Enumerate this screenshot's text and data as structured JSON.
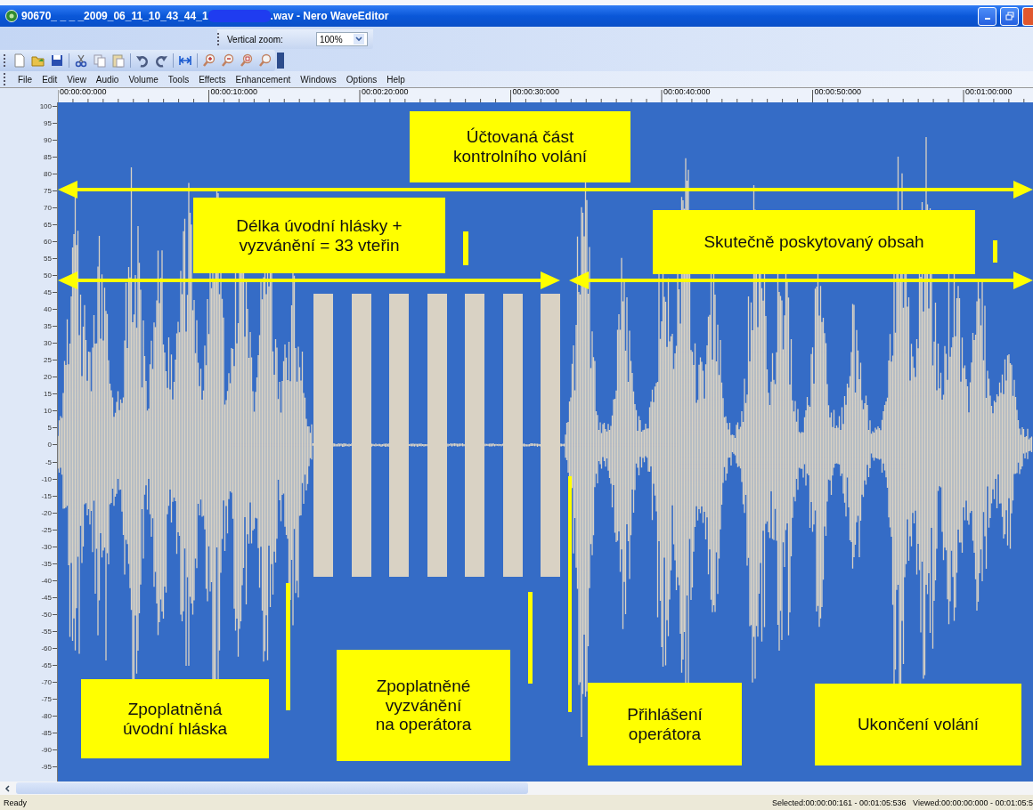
{
  "window": {
    "title_start": "90670_ _ _ _2009_06_11_10_43_44_1",
    "title_end": ".wav - Nero WaveEditor"
  },
  "toolbar": {
    "vertical_zoom_label": "Vertical zoom:",
    "vertical_zoom_value": "100%"
  },
  "menu": [
    "File",
    "Edit",
    "View",
    "Audio",
    "Volume",
    "Tools",
    "Effects",
    "Enhancement",
    "Windows",
    "Options",
    "Help"
  ],
  "ruler_labels": [
    "00:00:00:000",
    "00:00:10:000",
    "00:00:20:000",
    "00:00:30:000",
    "00:00:40:000",
    "00:00:50:000",
    "00:01:00:000"
  ],
  "y_axis_labels": [
    "100",
    "95",
    "90",
    "85",
    "80",
    "75",
    "70",
    "65",
    "60",
    "55",
    "50",
    "45",
    "40",
    "35",
    "30",
    "25",
    "20",
    "15",
    "10",
    "5",
    "0",
    "-5",
    "-10",
    "-15",
    "-20",
    "-25",
    "-30",
    "-35",
    "-40",
    "-45",
    "-50",
    "-55",
    "-60",
    "-65",
    "-70",
    "-75",
    "-80",
    "-85",
    "-90",
    "-95"
  ],
  "annotations": [
    {
      "text": "Účtovaná část\nkontrolního volání"
    },
    {
      "text": "Délka úvodní hlásky +\nvyzvánění = 33 vteřin"
    },
    {
      "text": "Skutečně poskytovaný obsah"
    },
    {
      "text": "Zpoplatněná\núvodní hláska"
    },
    {
      "text": "Zpoplatněné\nvyzvánění\nna operátora"
    },
    {
      "text": "Přihlášení\noperátora"
    },
    {
      "text": "Ukončení volání"
    }
  ],
  "status_bar": {
    "left": "Ready",
    "right": "Selected:00:00:00:161 - 00:01:05:536   Viewed:00:00:00:000 - 00:01:05:5"
  }
}
